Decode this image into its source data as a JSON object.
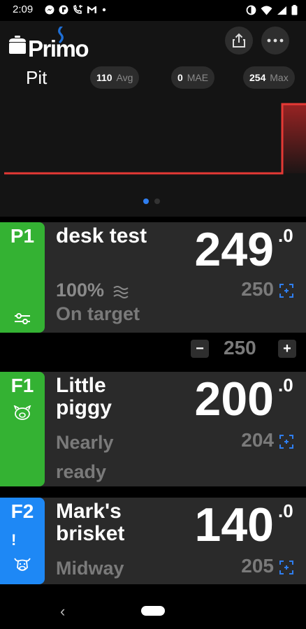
{
  "statusbar": {
    "time": "2:09",
    "left_icons": [
      "messenger-icon",
      "app-icon",
      "voicemail-icon",
      "gmail-icon",
      "notification-dot-icon"
    ],
    "right_icons": [
      "data-saver-icon",
      "wifi-icon",
      "signal-icon",
      "battery-icon"
    ]
  },
  "appbar": {
    "logo_text": "Primo",
    "share_icon": "share-icon",
    "more_icon": "more-horizontal-icon"
  },
  "pit": {
    "label": "Pit",
    "stats": [
      {
        "value": "110",
        "label": "Avg"
      },
      {
        "value": "0",
        "label": "MAE"
      },
      {
        "value": "254",
        "label": "Max"
      }
    ],
    "line_color": "#e53935",
    "pager": {
      "pages": 2,
      "active": 0,
      "active_color": "#2f7ef0",
      "inactive_color": "#333333"
    }
  },
  "probes": [
    {
      "id": "P1",
      "color": "#34b233",
      "name_lines": [
        "desk test"
      ],
      "temp": "249",
      "decimal": ".0",
      "output": "100%",
      "status": "On target",
      "target": "250",
      "tab_icon": "sliders-icon"
    },
    {
      "id": "F1",
      "color": "#34b233",
      "name_lines": [
        "Little",
        "piggy"
      ],
      "temp": "200",
      "decimal": ".0",
      "status_lines": [
        "Nearly",
        "ready"
      ],
      "target": "204",
      "tab_icon": "pig-icon"
    },
    {
      "id": "F2",
      "color": "#1e88f5",
      "alert": "!",
      "name_lines": [
        "Mark's",
        "brisket"
      ],
      "temp": "140",
      "decimal": ".0",
      "status": "Midway",
      "target": "205",
      "tab_icon": "cow-icon"
    }
  ],
  "setpoint": {
    "minus": "−",
    "value": "250",
    "plus": "+"
  },
  "navbar": {
    "back": "‹"
  }
}
